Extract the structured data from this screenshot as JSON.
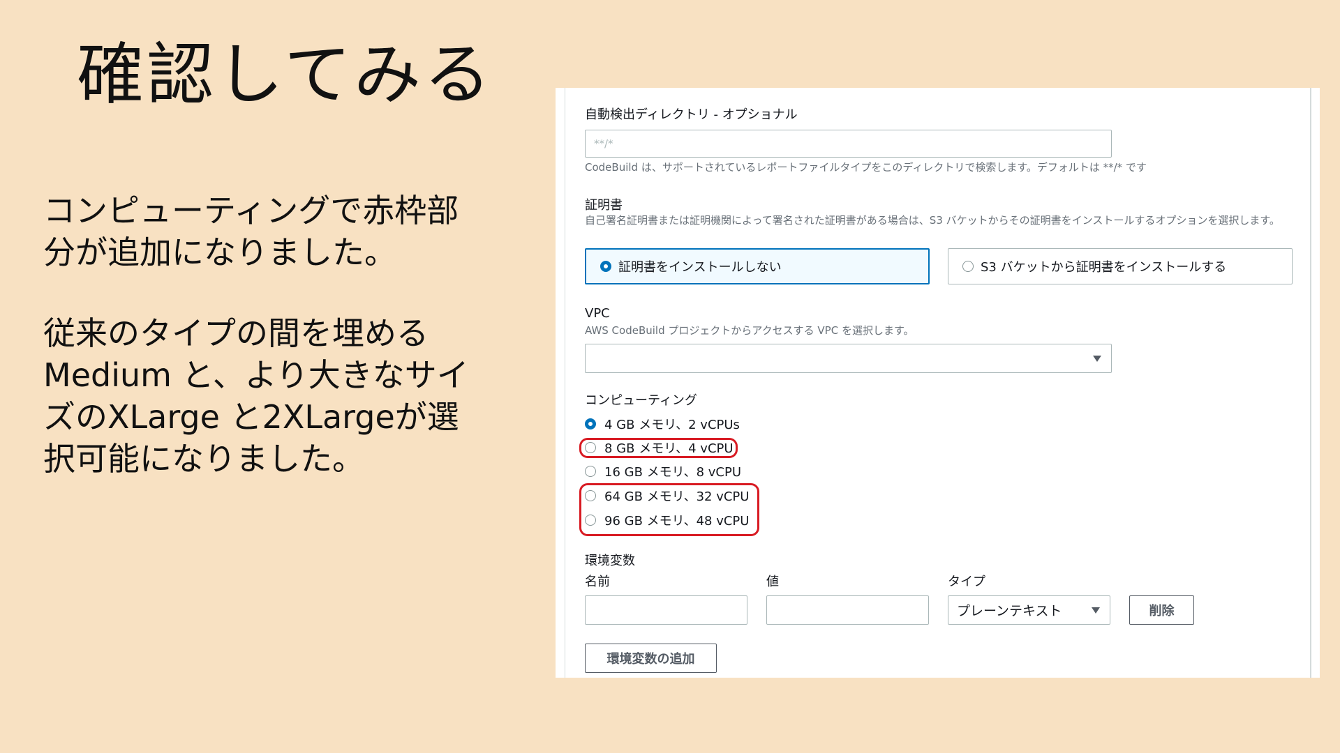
{
  "slide": {
    "title": "確認してみる",
    "desc_1": "コンピューティングで赤枠部分が追加になりました。",
    "desc_2": "従来のタイプの間を埋めるMedium と、より大きなサイズのXLarge と2XLargeが選択可能になりました。"
  },
  "form": {
    "report_dir": {
      "label": "自動検出ディレクトリ - オプショナル",
      "placeholder": "**/*",
      "hint": "CodeBuild は、サポートされているレポートファイルタイプをこのディレクトリで検索します。デフォルトは **/* です"
    },
    "certificate": {
      "label": "証明書",
      "hint": "自己署名証明書または証明機関によって署名された証明書がある場合は、S3 バケットからその証明書をインストールするオプションを選択します。",
      "options": [
        {
          "label": "証明書をインストールしない",
          "selected": true
        },
        {
          "label": "S3 バケットから証明書をインストールする",
          "selected": false
        }
      ]
    },
    "vpc": {
      "label": "VPC",
      "hint": "AWS CodeBuild プロジェクトからアクセスする VPC を選択します。",
      "value": ""
    },
    "compute": {
      "label": "コンピューティング",
      "options": [
        {
          "label": "4 GB メモリ、2 vCPUs",
          "selected": true
        },
        {
          "label": "8 GB メモリ、4 vCPU",
          "selected": false
        },
        {
          "label": "16 GB メモリ、8 vCPU",
          "selected": false
        },
        {
          "label": "64 GB メモリ、32 vCPU",
          "selected": false
        },
        {
          "label": "96 GB メモリ、48 vCPU",
          "selected": false
        }
      ]
    },
    "env": {
      "label": "環境変数",
      "name_label": "名前",
      "value_label": "値",
      "type_label": "タイプ",
      "name_value": "",
      "value_value": "",
      "type_value": "プレーンテキスト",
      "remove_button": "削除",
      "add_button": "環境変数の追加"
    }
  },
  "colors": {
    "slide_bg": "#f8e1c2",
    "highlight": "#d81b23",
    "aws_blue": "#0073bb"
  }
}
